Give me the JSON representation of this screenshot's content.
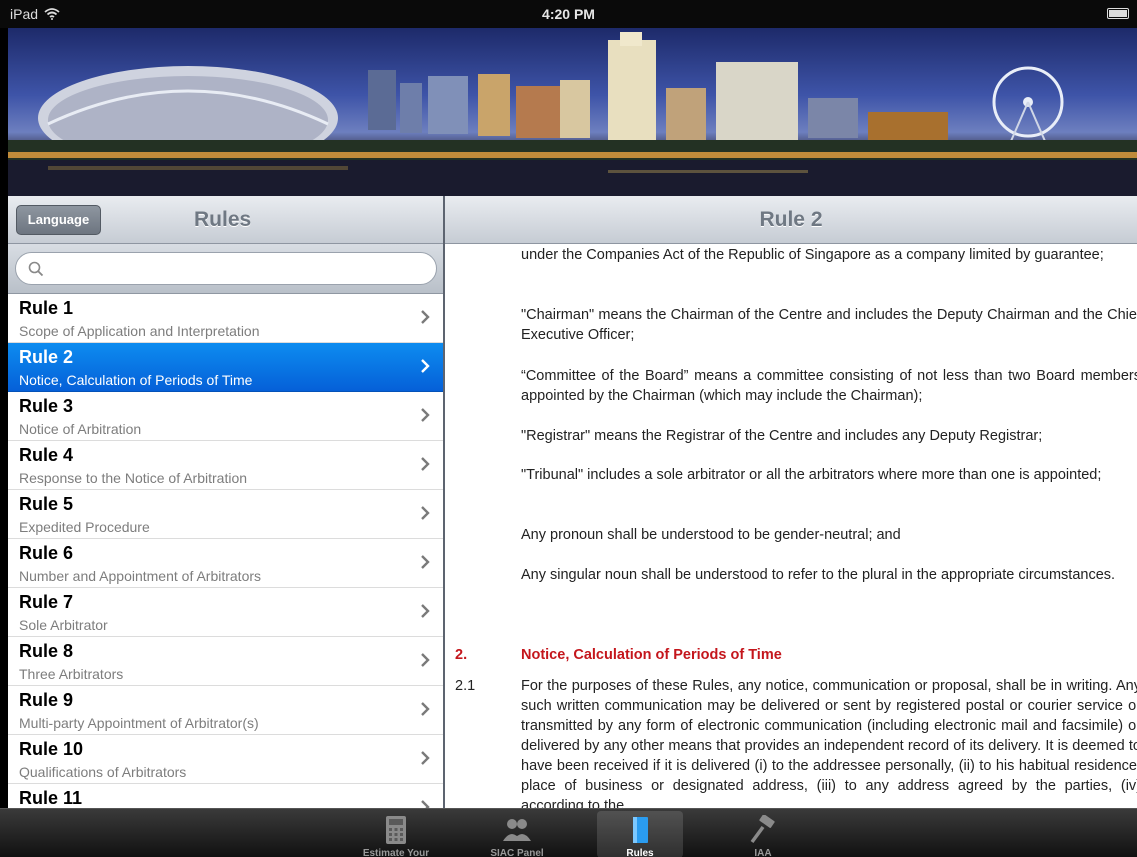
{
  "status": {
    "device": "iPad",
    "time": "4:20 PM"
  },
  "master": {
    "language_button": "Language",
    "title": "Rules",
    "search_placeholder": "",
    "items": [
      {
        "title": "Rule 1",
        "subtitle": "Scope of Application and Interpretation"
      },
      {
        "title": "Rule 2",
        "subtitle": "Notice, Calculation of Periods of Time"
      },
      {
        "title": "Rule 3",
        "subtitle": "Notice of Arbitration"
      },
      {
        "title": "Rule 4",
        "subtitle": "Response to the Notice of Arbitration"
      },
      {
        "title": "Rule 5",
        "subtitle": "Expedited Procedure"
      },
      {
        "title": "Rule 6",
        "subtitle": "Number and Appointment of Arbitrators"
      },
      {
        "title": "Rule 7",
        "subtitle": "Sole Arbitrator"
      },
      {
        "title": "Rule 8",
        "subtitle": "Three Arbitrators"
      },
      {
        "title": "Rule 9",
        "subtitle": "Multi-party Appointment of Arbitrator(s)"
      },
      {
        "title": "Rule 10",
        "subtitle": "Qualifications of Arbitrators"
      },
      {
        "title": "Rule 11",
        "subtitle": ""
      }
    ],
    "selected_index": 1
  },
  "detail": {
    "title": "Rule 2",
    "paragraphs": [
      "under the Companies Act of the Republic of Singapore as a company limited by guarantee;",
      "\"Chairman\" means the Chairman of the Centre and includes the Deputy Chairman and the Chief Executive Officer;",
      "“Committee of the Board” means a committee consisting of not less than two Board members appointed by the Chairman (which may include the Chairman);",
      "\"Registrar\" means the Registrar of the Centre and includes any Deputy Registrar;",
      "\"Tribunal\" includes a sole arbitrator or all the arbitrators where more than one is appointed;",
      "Any pronoun shall be understood to be gender-neutral; and",
      "Any singular noun shall be understood to refer to the plural in the appropriate circumstances."
    ],
    "section_number": "2.",
    "section_heading": "Notice, Calculation of Periods of Time",
    "clause_number": "2.1",
    "clause_text": "For the purposes of these Rules, any notice, communication or proposal, shall be in writing. Any such written communication may be delivered or sent by registered postal or courier service or transmitted by any form of electronic communication (including electronic mail and facsimile) or delivered by any other means that provides an independent record of its delivery. It is deemed to have been received if it is delivered (i) to the addressee personally, (ii) to his habitual residence, place of business or designated address, (iii) to any address agreed by the parties, (iv) according to the"
  },
  "tabs": [
    {
      "label": "Estimate Your Fees",
      "icon": "calculator-icon"
    },
    {
      "label": "SIAC Panel",
      "icon": "people-icon"
    },
    {
      "label": "Rules",
      "icon": "book-icon"
    },
    {
      "label": "IAA",
      "icon": "gavel-icon"
    }
  ],
  "active_tab": 2,
  "colors": {
    "selection": "#0a78e6",
    "heading": "#c4161c"
  }
}
